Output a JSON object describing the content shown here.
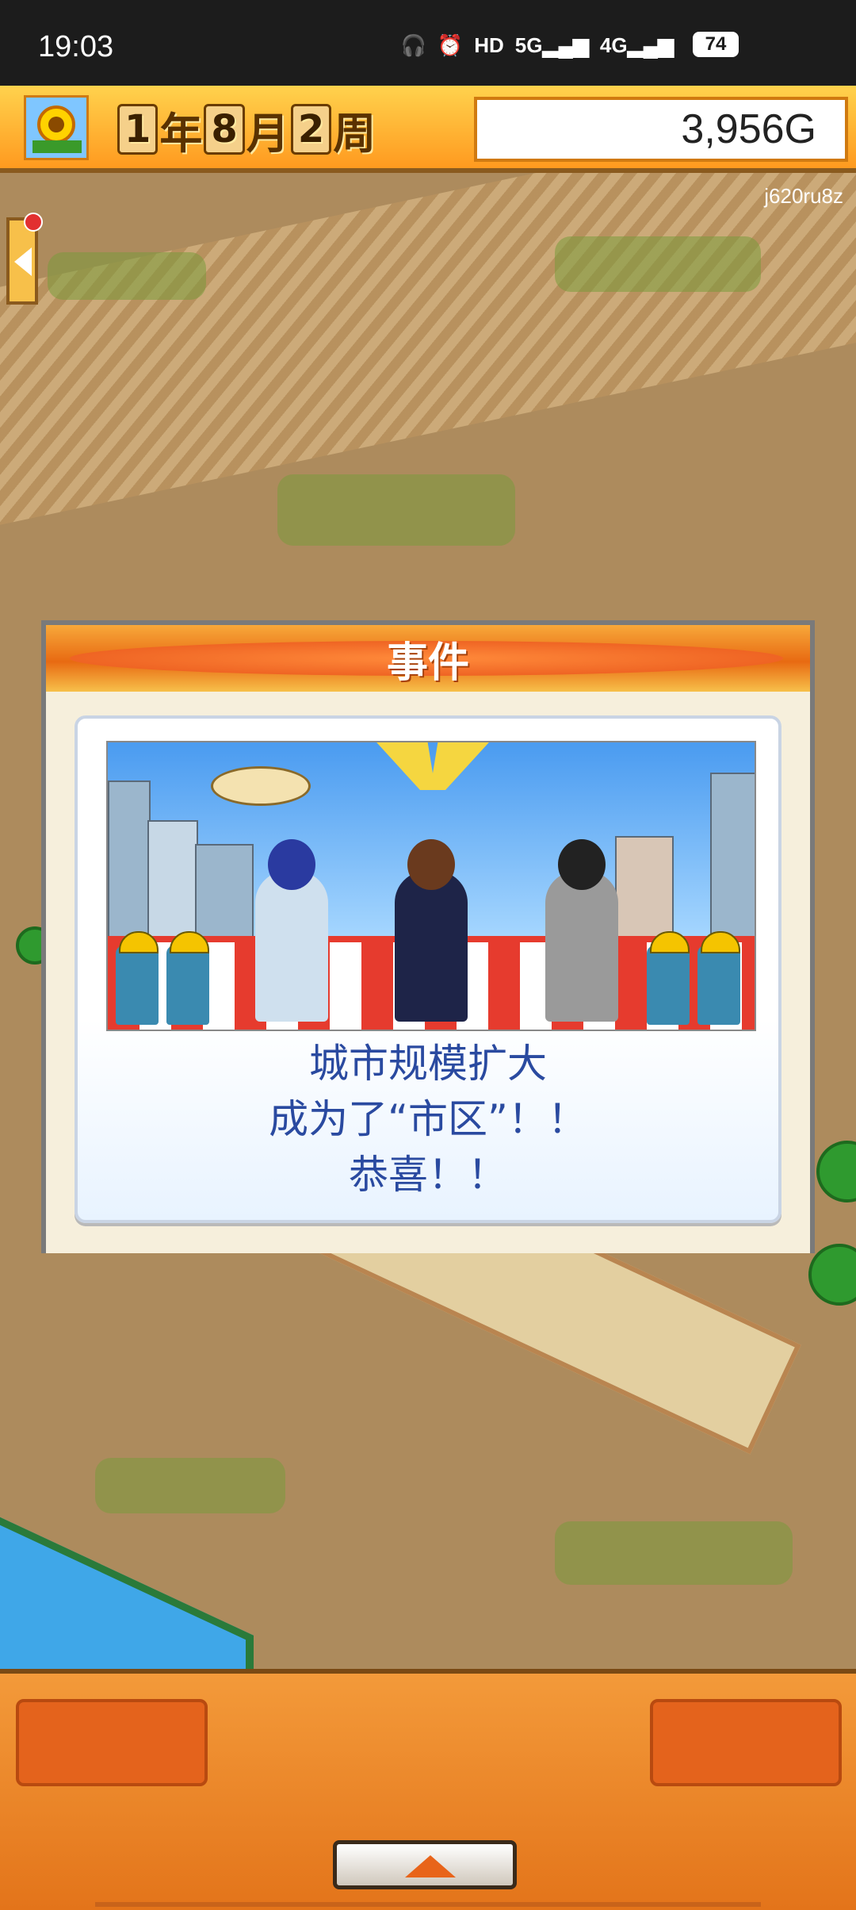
{
  "status_bar": {
    "time": "19:03",
    "icons": [
      "headphones-icon",
      "alarm-icon",
      "hd-icon",
      "signal-5g-icon",
      "signal-4g-icon"
    ],
    "hd_label": "HD",
    "net_5g": "5G",
    "net_4g": "4G",
    "battery": "74"
  },
  "top_bar": {
    "year_num": "1",
    "year_unit": "年",
    "month_num": "8",
    "month_unit": "月",
    "week_num": "2",
    "week_unit": "周",
    "money": "3,956G"
  },
  "map": {
    "watermark": "j620ru8z"
  },
  "event_dialog": {
    "title": "事件",
    "lines": [
      "城市规模扩大",
      "成为了“市区”！！",
      "恭喜！！"
    ]
  },
  "colors": {
    "accent": "#e86a12",
    "message_text": "#2a4aa0",
    "money_bg": "#ffffff"
  }
}
